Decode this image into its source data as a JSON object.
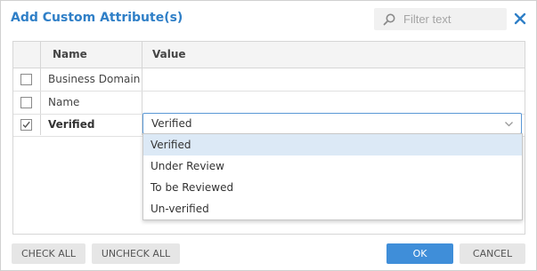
{
  "dialog": {
    "title": "Add Custom Attribute(s)",
    "filter_placeholder": "Filter text",
    "accent_color": "#2f7fc7"
  },
  "grid": {
    "columns": [
      "Name",
      "Value"
    ],
    "rows": [
      {
        "name": "Business Domain",
        "checked": false,
        "value": ""
      },
      {
        "name": "Name",
        "checked": false,
        "value": ""
      },
      {
        "name": "Verified",
        "checked": true,
        "value": "Verified"
      }
    ]
  },
  "dropdown": {
    "selected": "Verified",
    "options": [
      "Verified",
      "Under Review",
      "To be Reviewed",
      "Un-verified"
    ]
  },
  "buttons": {
    "check_all": "CHECK ALL",
    "uncheck_all": "UNCHECK ALL",
    "ok": "OK",
    "cancel": "CANCEL"
  },
  "icons": [
    "search-icon",
    "close-icon",
    "checkbox-icon",
    "checkmark-icon",
    "chevron-down-icon"
  ]
}
